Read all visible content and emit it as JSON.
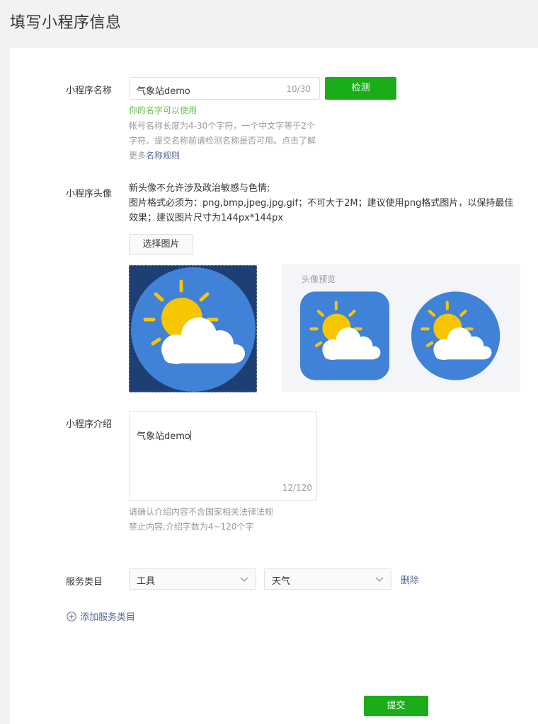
{
  "page": {
    "title": "填写小程序信息"
  },
  "name_section": {
    "label": "小程序名称",
    "input_value": "气象站demo",
    "counter": "10/30",
    "check_button": "检测",
    "success_text": "你的名字可以使用",
    "hint_text": "帐号名称长度为4-30个字符，一个中文字等于2个字符。提交名称前请检测名称是否可用。点击了解更多",
    "hint_link": "名称规则"
  },
  "avatar_section": {
    "label": "小程序头像",
    "desc_line1": "新头像不允许涉及政治敏感与色情;",
    "desc_line2": "图片格式必须为：png,bmp,jpeg,jpg,gif；不可大于2M；建议使用png格式图片，以保持最佳效果；建议图片尺寸为144px*144px",
    "select_button": "选择图片",
    "preview_title": "头像预览",
    "icon_name": "weather-sun-cloud-icon"
  },
  "intro_section": {
    "label": "小程序介绍",
    "value": "气象站demo",
    "counter": "12/120",
    "hint_line1": "请确认介绍内容不含国家相关法律法规",
    "hint_line2": "禁止内容,介绍字数为4~120个字"
  },
  "category_section": {
    "label": "服务类目",
    "primary_value": "工具",
    "secondary_value": "天气",
    "delete_link": "删除",
    "add_link": "添加服务类目"
  },
  "submit_button": "提交",
  "colors": {
    "primary_green": "#1aad19",
    "success_green": "#6cbf4e",
    "link_blue": "#576b95",
    "icon_blue": "#3f82d8",
    "sun_yellow": "#f7c600"
  }
}
